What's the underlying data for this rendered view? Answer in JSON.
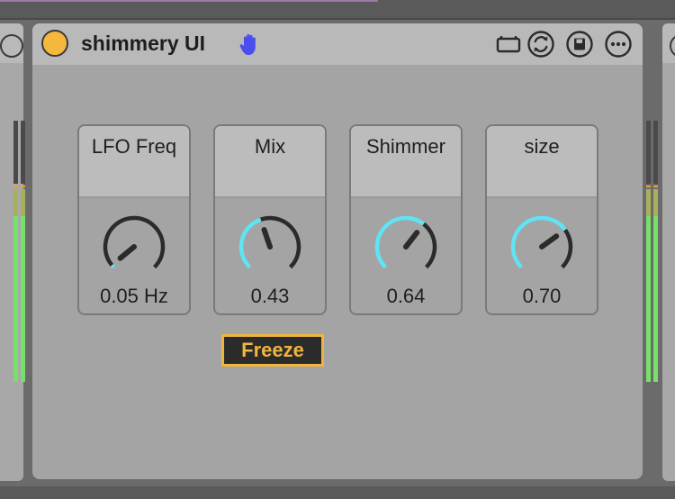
{
  "device": {
    "title": "shimmery UI",
    "power_color": "#f5b73c",
    "hand_color": "#4a4ef0",
    "toolbar_icons": [
      "clip-icon",
      "refresh-icon",
      "save-icon",
      "more-icon"
    ]
  },
  "dials": [
    {
      "label": "LFO Freq",
      "value": "0.05 Hz",
      "fraction": 0.02
    },
    {
      "label": "Mix",
      "value": "0.43",
      "fraction": 0.43
    },
    {
      "label": "Shimmer",
      "value": "0.64",
      "fraction": 0.64
    },
    {
      "label": "size",
      "value": "0.70",
      "fraction": 0.7
    }
  ],
  "freeze": {
    "label": "Freeze",
    "color": "#f0b53c"
  },
  "colors": {
    "knob_arc": "#5fe4f4",
    "knob_track": "#2b2b2b",
    "meter_green": "#77e06a"
  }
}
